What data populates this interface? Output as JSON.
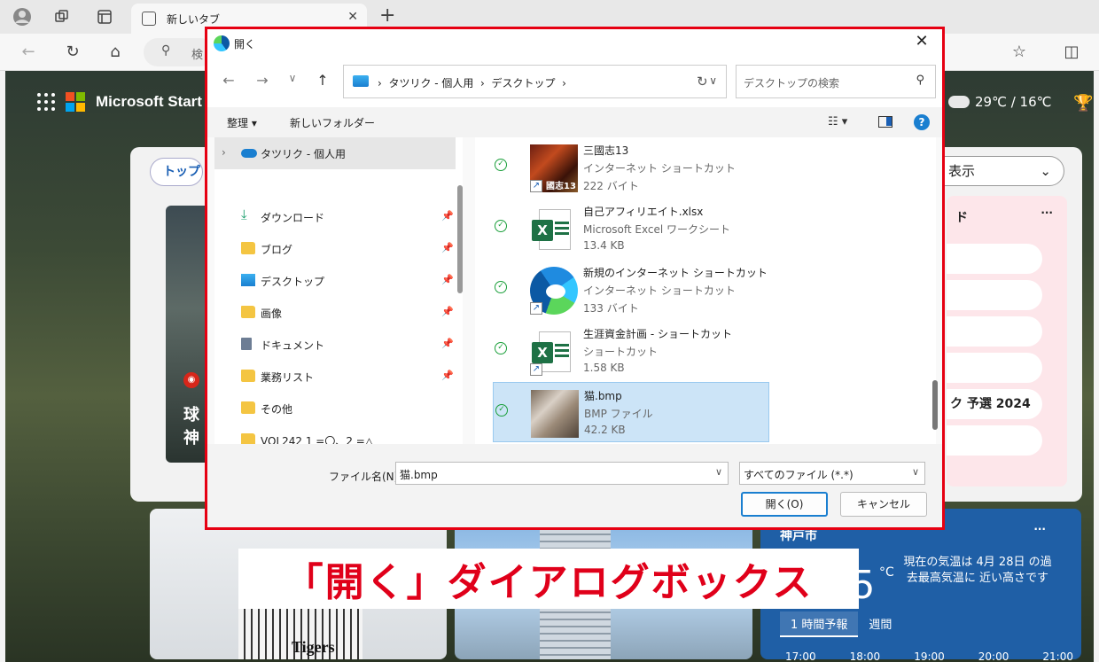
{
  "browser": {
    "tab_title": "新しいタブ",
    "address_text": "検",
    "colors": {
      "accent": "#1a7fd0",
      "highlight_border": "#e60012"
    }
  },
  "page": {
    "brand": "Microsoft Start",
    "weather_top": "29℃ / 16℃",
    "top_chip": "トップ",
    "display_select": "表示",
    "news_headline_line1": "球",
    "news_headline_line2": "神",
    "trend_title": "ド",
    "trend_more": "···",
    "trend_item_label": "ク 予選 2024",
    "tigers_text": "Tigers",
    "kobe": {
      "city": "神戸市",
      "more": "···",
      "temp": "5",
      "unit": "°C",
      "note": "現在の気温は 4月 28日 の過去最高気温に 近い高さです",
      "tab_hourly": "1 時間予報",
      "tab_weekly": "週間",
      "hours": [
        "17:00",
        "18:00",
        "19:00",
        "20:00",
        "21:00"
      ]
    }
  },
  "caption": "「開く」ダイアログボックス",
  "dialog": {
    "title": "開く",
    "breadcrumb": [
      "タツリク - 個人用",
      "デスクトップ"
    ],
    "search_placeholder": "デスクトップの検索",
    "cmd_organize": "整理",
    "cmd_new_folder": "新しいフォルダー",
    "nav_tree": {
      "onedrive": "タツリク - 個人用",
      "items": [
        {
          "label": "ダウンロード",
          "icon": "download-icon",
          "pinned": true
        },
        {
          "label": "ブログ",
          "icon": "folder-icon",
          "pinned": true
        },
        {
          "label": "デスクトップ",
          "icon": "desktop-folder-icon",
          "pinned": true
        },
        {
          "label": "画像",
          "icon": "folder-icon",
          "pinned": true
        },
        {
          "label": "ドキュメント",
          "icon": "document-icon",
          "pinned": true
        },
        {
          "label": "業務リスト",
          "icon": "folder-icon",
          "pinned": true
        },
        {
          "label": "その他",
          "icon": "folder-icon",
          "pinned": false
        },
        {
          "label": "VOL242 1 =〇、2 =△",
          "icon": "folder-icon",
          "pinned": false
        }
      ]
    },
    "files": [
      {
        "name": "三國志13",
        "type": "インターネット ショートカット",
        "size": "222 バイト",
        "thumb": "game-thumbnail",
        "thumb_text": "國志13",
        "shortcut": true
      },
      {
        "name": "自己アフィリエイト.xlsx",
        "type": "Microsoft Excel ワークシート",
        "size": "13.4 KB",
        "thumb": "excel-icon",
        "shortcut": false
      },
      {
        "name": "新規のインターネット ショートカット",
        "type": "インターネット ショートカット",
        "size": "133 バイト",
        "thumb": "edge-icon",
        "shortcut": true
      },
      {
        "name": "生涯資金計画 - ショートカット",
        "type": "ショートカット",
        "size": "1.58 KB",
        "thumb": "excel-icon",
        "shortcut": true
      },
      {
        "name": "猫.bmp",
        "type": "BMP ファイル",
        "size": "42.2 KB",
        "thumb": "cat-thumbnail",
        "shortcut": false,
        "selected": true
      }
    ],
    "filename_label": "ファイル名(N):",
    "filename_value": "猫.bmp",
    "filetype_value": "すべてのファイル (*.*)",
    "open_button": "開く(O)",
    "cancel_button": "キャンセル"
  }
}
